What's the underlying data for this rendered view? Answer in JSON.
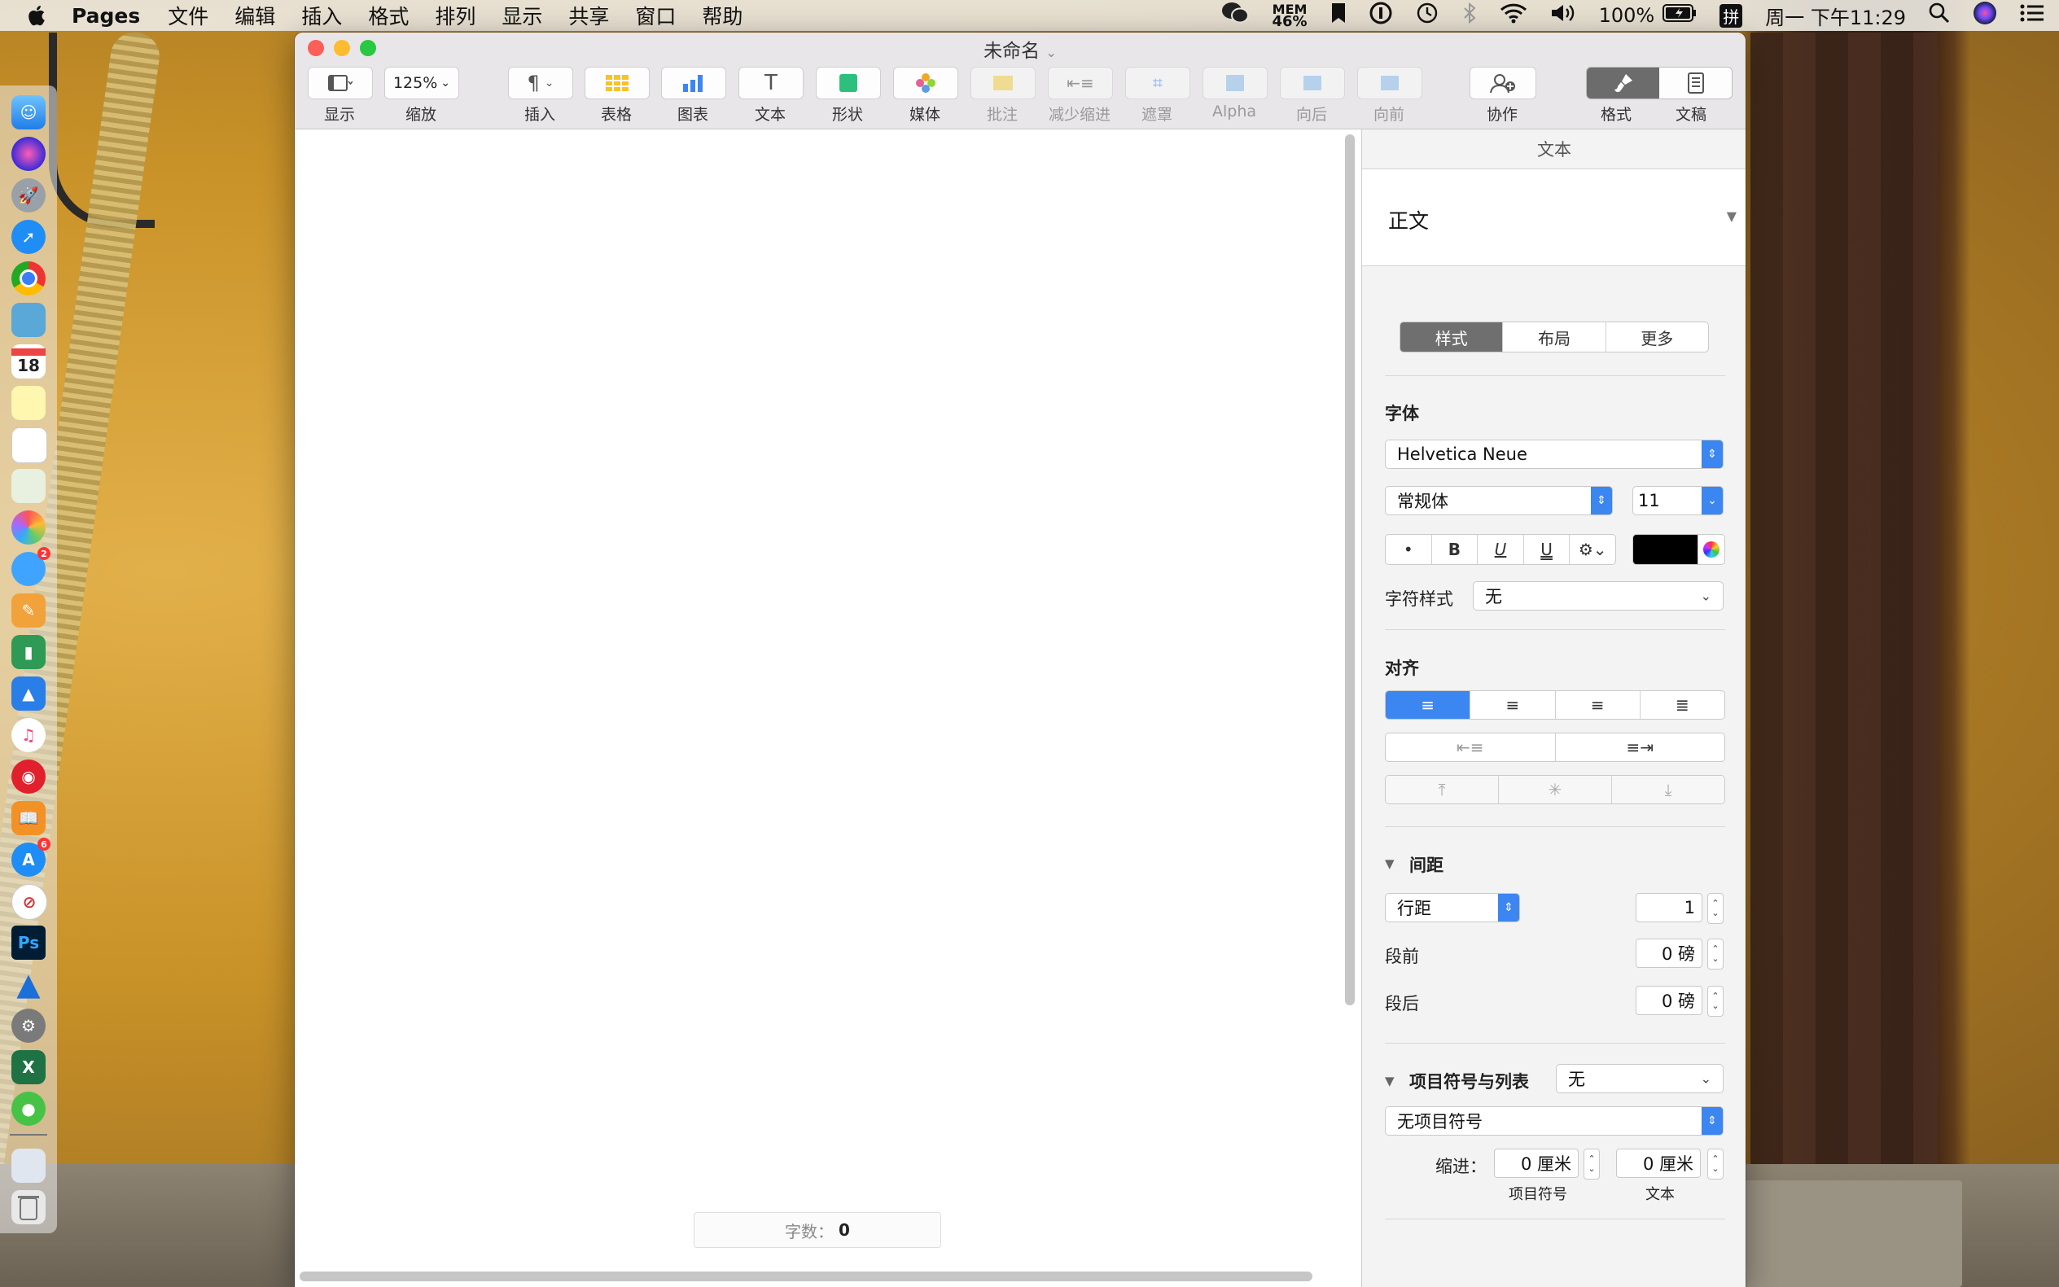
{
  "menubar": {
    "app_name": "Pages",
    "items": [
      "文件",
      "编辑",
      "插入",
      "格式",
      "排列",
      "显示",
      "共享",
      "窗口",
      "帮助"
    ],
    "mem_label": "MEM",
    "mem_value": "46%",
    "battery": "100%",
    "input_method": "拼",
    "clock": "周一 下午11:29"
  },
  "window": {
    "title": "未命名",
    "toolbar": {
      "view": "显示",
      "zoom_value": "125%",
      "zoom": "缩放",
      "insert": "插入",
      "table": "表格",
      "chart": "图表",
      "text": "文本",
      "shape": "形状",
      "media": "媒体",
      "comment": "批注",
      "decrease_indent": "减少缩进",
      "mask": "遮罩",
      "alpha": "Alpha",
      "backward": "向后",
      "forward": "向前",
      "collaborate": "协作",
      "format": "格式",
      "document": "文稿"
    },
    "word_count_label": "字数：",
    "word_count_value": "0"
  },
  "inspector": {
    "header": "文本",
    "paragraph_style": "正文",
    "tabs": [
      "样式",
      "布局",
      "更多"
    ],
    "font_section": "字体",
    "font_name": "Helvetica Neue",
    "font_weight": "常规体",
    "font_size": "11",
    "bold": "B",
    "italic": "I",
    "underline": "U",
    "strike": "U",
    "text_color": "#000000",
    "char_style_label": "字符样式",
    "char_style_value": "无",
    "align_section": "对齐",
    "spacing_section": "间距",
    "line_spacing_mode": "行距",
    "line_spacing_value": "1",
    "before_label": "段前",
    "before_value": "0 磅",
    "after_label": "段后",
    "after_value": "0 磅",
    "bullets_section": "项目符号与列表",
    "bullets_value": "无",
    "bullet_type": "无项目符号",
    "indent_label": "缩进：",
    "indent_bullet_value": "0 厘米",
    "indent_text_value": "0 厘米",
    "indent_bullet_caption": "项目符号",
    "indent_text_caption": "文本"
  },
  "dock": {
    "calendar_day": "18",
    "messages_badge": "2",
    "appstore_badge": "6"
  }
}
